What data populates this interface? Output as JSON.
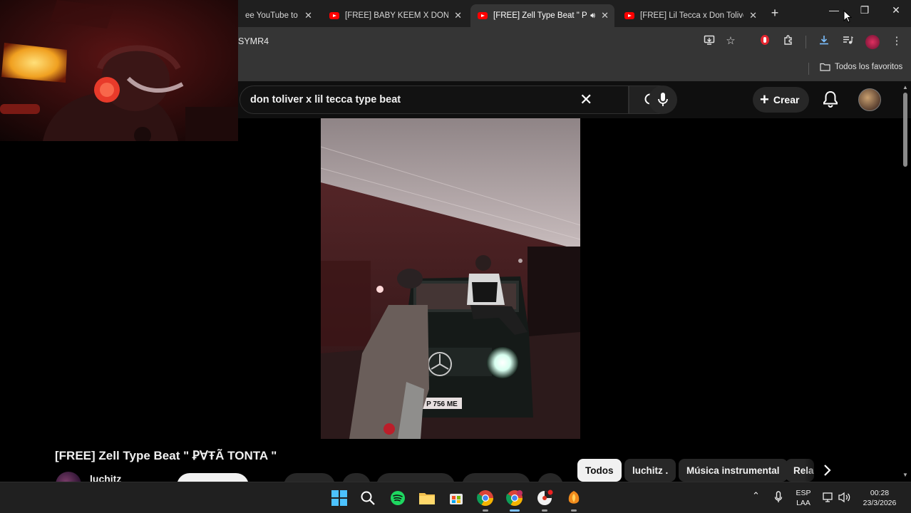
{
  "browser": {
    "tabs": [
      {
        "title": "ee YouTube to M",
        "active": false
      },
      {
        "title": "[FREE] BABY KEEM X DON TO",
        "active": false
      },
      {
        "title": "[FREE] Zell Type Beat \" P",
        "active": true,
        "audio": true
      },
      {
        "title": "[FREE] Lil Tecca x Don Toliver",
        "active": false
      }
    ],
    "new_tab_label": "+",
    "url": "SYMR4",
    "bookmarks_label": "Todos los favoritos",
    "window_buttons": {
      "minimize": "—",
      "restore": "❐",
      "close": "✕"
    }
  },
  "youtube": {
    "search_value": "don toliver x lil tecca type beat",
    "create_label": "Crear",
    "video": {
      "title": "[FREE] Zell Type Beat \" ꝐⱯŦÃ TONTA \"",
      "channel": "luchitz",
      "plate_text": "P 756 ME"
    },
    "chips": [
      {
        "label": "Todos",
        "active": true
      },
      {
        "label": "luchitz .",
        "active": false
      },
      {
        "label": "Música instrumental",
        "active": false
      },
      {
        "label": "Rela",
        "active": false
      }
    ]
  },
  "taskbar": {
    "lang_top": "ESP",
    "lang_bottom": "LAA",
    "time": "00:28",
    "date": "23/3/2026"
  },
  "colors": {
    "youtube_red": "#ff0000",
    "chrome_dark": "#1f1f1f",
    "toolbar": "#353535",
    "page_bg": "#0f0f0f"
  }
}
